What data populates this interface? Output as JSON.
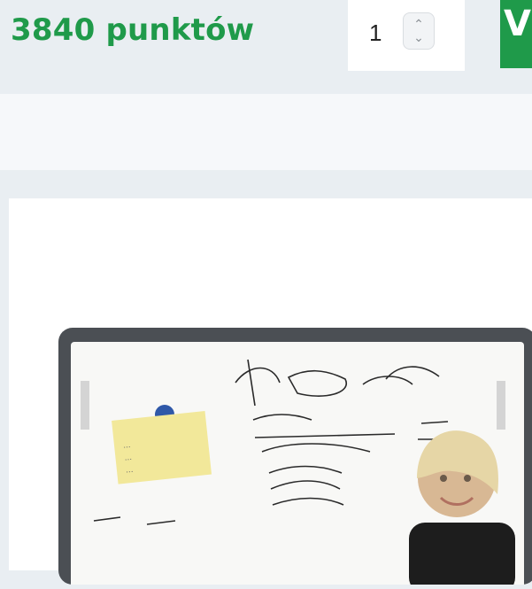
{
  "product": {
    "points_label": "3840 punktów",
    "quantity": "1",
    "cart_button_glyph": "V"
  },
  "image": {
    "description": "interactive whiteboard",
    "note_lines": [
      "...",
      "...",
      "..."
    ],
    "colors": {
      "accent": "#1f9a4a",
      "background": "#e9eef2"
    }
  }
}
